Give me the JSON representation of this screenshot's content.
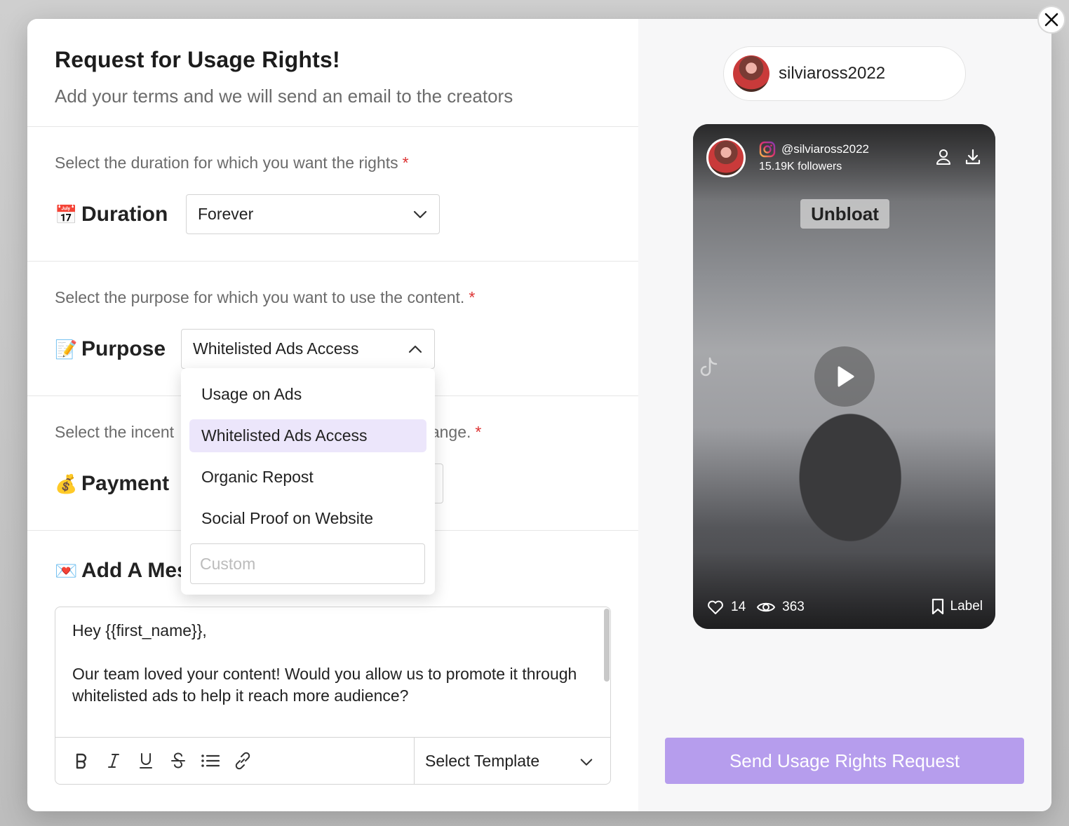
{
  "header": {
    "title": "Request for Usage Rights!",
    "subtitle": "Add your terms and we will send an email to the creators"
  },
  "duration": {
    "prompt": "Select the duration for which you want the rights",
    "required_mark": "*",
    "emoji": "📅",
    "label": "Duration",
    "value": "Forever"
  },
  "purpose": {
    "prompt": "Select the purpose for which you want to use the content.",
    "required_mark": "*",
    "emoji": "📝",
    "label": "Purpose",
    "value": "Whitelisted Ads Access",
    "options": [
      "Usage on Ads",
      "Whitelisted Ads Access",
      "Organic Repost",
      "Social Proof on Website"
    ],
    "custom_placeholder": "Custom"
  },
  "payment": {
    "prompt_start": "Select the incent",
    "prompt_end": "nange.",
    "required_mark": "*",
    "emoji": "💰",
    "label": "Payment"
  },
  "message": {
    "emoji": "💌",
    "label": "Add A Mes",
    "lines": [
      "Hey {{first_name}},",
      "Our team loved your content! Would you allow us to promote it through whitelisted ads to help it reach more audience?"
    ],
    "template_placeholder": "Select Template",
    "tools": [
      "bold-icon",
      "italic-icon",
      "underline-icon",
      "strikethrough-icon",
      "list-icon",
      "link-icon"
    ]
  },
  "creator": {
    "username": "silviaross2022",
    "handle": "@silviaross2022",
    "followers": "15.19K followers",
    "overlay_text": "Unbloat",
    "likes": "14",
    "views": "363",
    "label_text": "Label"
  },
  "actions": {
    "send_label": "Send Usage Rights Request"
  },
  "colors": {
    "accent": "#b69ded",
    "selected_option": "#ece6fb",
    "required": "#dd3333"
  }
}
